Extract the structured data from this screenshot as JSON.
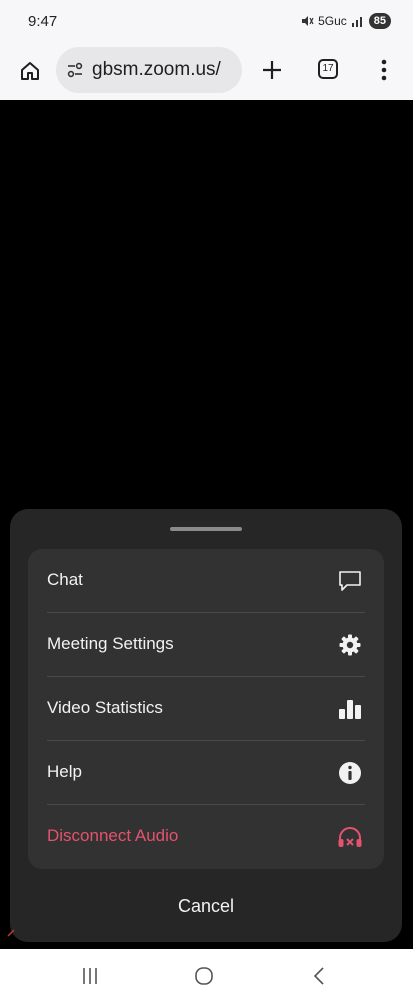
{
  "status_bar": {
    "time": "9:47",
    "network": "5Guc",
    "battery": "85"
  },
  "browser": {
    "url": "gbsm.zoom.us/",
    "tab_count": "17",
    "icons": [
      "home-icon",
      "site-settings-icon",
      "new-tab-icon",
      "tab-switcher-icon",
      "more-menu-icon"
    ]
  },
  "sheet": {
    "items": [
      {
        "label": "Chat",
        "icon": "chat-bubble-icon"
      },
      {
        "label": "Meeting Settings",
        "icon": "gear-icon"
      },
      {
        "label": "Video Statistics",
        "icon": "bar-chart-icon"
      },
      {
        "label": "Help",
        "icon": "info-icon"
      },
      {
        "label": "Disconnect Audio",
        "icon": "headphones-disconnect-icon",
        "color": "#e4526e"
      }
    ],
    "cancel_label": "Cancel"
  },
  "nav": {
    "icons": [
      "recent-apps-icon",
      "home-circle-icon",
      "back-icon"
    ]
  },
  "colors": {
    "sheet_bg": "#262626",
    "card_bg": "#323232",
    "danger": "#e4526e"
  }
}
